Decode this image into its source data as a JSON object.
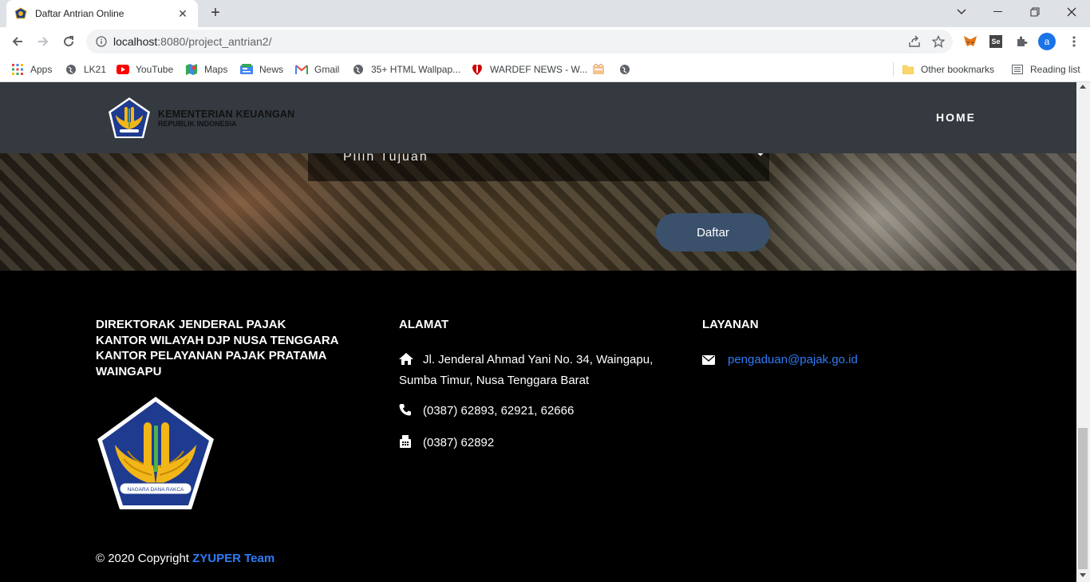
{
  "browser": {
    "tab_title": "Daftar Antrian Online",
    "url_host": "localhost",
    "url_path": ":8080/project_antrian2/",
    "profile_initial": "a",
    "bookmarks": [
      "Apps",
      "LK21",
      "YouTube",
      "Maps",
      "News",
      "Gmail",
      "35+ HTML Wallpap...",
      "WARDEF NEWS - W..."
    ],
    "other_bookmarks": "Other bookmarks",
    "reading_list": "Reading list",
    "se_badge": "Se"
  },
  "navbar": {
    "logo_line1": "KEMENTERIAN KEUANGAN",
    "logo_line2": "REPUBLIK INDONESIA",
    "home": "HOME"
  },
  "form": {
    "select_value": "Pilih Tujuan",
    "submit_label": "Daftar"
  },
  "footer": {
    "col1_lines": [
      "DIREKTORAK JENDERAL PAJAK",
      "KANTOR WILAYAH DJP NUSA TENGGARA",
      "KANTOR PELAYANAN PAJAK PRATAMA",
      "WAINGAPU"
    ],
    "alamat_title": "ALAMAT",
    "address_line1": "Jl. Jenderal Ahmad Yani No. 34, Waingapu,",
    "address_line2": "Sumba Timur, Nusa Tenggara Barat",
    "phone": "(0387) 62893, 62921, 62666",
    "fax": "(0387) 62892",
    "layanan_title": "LAYANAN",
    "email": "pengaduan@pajak.go.id",
    "copyright_prefix": "© 2020 Copyright",
    "copyright_team": "ZYUPER Team",
    "seal_text": "NAGARA DANA RAKCA"
  },
  "colors": {
    "navbar_bg": "#343a40",
    "button_bg": "#3a506b",
    "link": "#2f7cf6",
    "seal_blue": "#1f3b8f",
    "seal_gold": "#f2b619"
  }
}
